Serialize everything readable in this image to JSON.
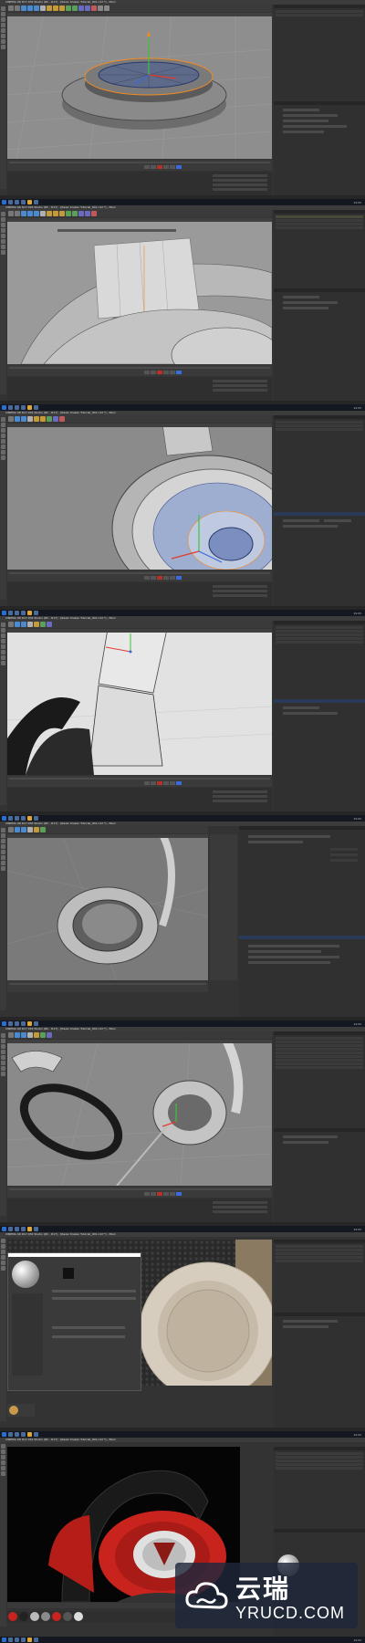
{
  "app": {
    "title": "CINEMA 4D R17.032 Studio (RC - R17) - [Razer Kraken Tutorial_001.c4d *] - Main",
    "menu": [
      "File",
      "Edit",
      "Create",
      "Select",
      "Tools",
      "Mesh",
      "Snap",
      "Animate",
      "Simulate",
      "Render",
      "Sculpt",
      "Motion Tracker",
      "MoGraph",
      "Character",
      "Pipeline",
      "Plugins",
      "Script",
      "Window",
      "Help"
    ]
  },
  "taskbar": {
    "clock": "19:05"
  },
  "watermark": {
    "cn": "云瑞",
    "en": "YRUCD.COM"
  },
  "colors": {
    "viewport_bg": "#8e8e8e",
    "panel_bg": "#303030",
    "accent_orange": "#f08a24",
    "axis_red": "#e23b2e",
    "axis_green": "#3cc43c",
    "axis_blue": "#3a6ae0",
    "render_red": "#c8231d"
  },
  "frames": [
    {
      "name": "frame-1-disc-modeling"
    },
    {
      "name": "frame-2-headband-top"
    },
    {
      "name": "frame-3-earcup-ring"
    },
    {
      "name": "frame-4-headband-joint"
    },
    {
      "name": "frame-5-earcup-cushion"
    },
    {
      "name": "frame-6-earcups-and-cable"
    },
    {
      "name": "frame-7-material-editor"
    },
    {
      "name": "frame-8-final-render"
    }
  ]
}
